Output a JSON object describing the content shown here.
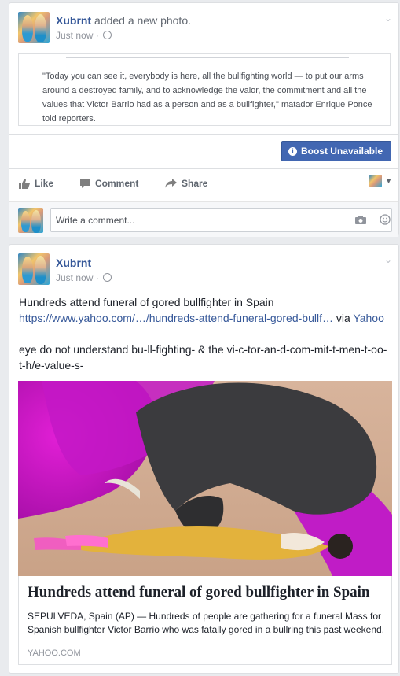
{
  "post1": {
    "author": "Xubrnt",
    "action": "added a new photo.",
    "timestamp": "Just now",
    "quote": "\"Today you can see it, everybody is here, all the bullfighting world — to put our arms around a destroyed family, and to acknowledge the valor, the commitment and all the values that Victor Barrio had as a person and as a bullfighter,\" matador Enrique Ponce told reporters.",
    "boost_label": "Boost Unavailable",
    "actions": {
      "like": "Like",
      "comment": "Comment",
      "share": "Share"
    },
    "comment_placeholder": "Write a comment..."
  },
  "post2": {
    "author": "Xubrnt",
    "timestamp": "Just now",
    "text_line1": "Hundreds attend funeral of gored bullfighter in Spain",
    "link_url": "https://www.yahoo.com/…/hundreds-attend-funeral-gored-bullf…",
    "via": "via",
    "via_source": "Yahoo",
    "comment_text": "eye do not understand bu-ll-fighting- & the vi-c-tor-an-d-com-mit-t-men-t-oo-t-h/e-value-s-",
    "link_preview": {
      "title": "Hundreds attend funeral of gored bullfighter in Spain",
      "description": "SEPULVEDA, Spain (AP) — Hundreds of people are gathering for a funeral Mass for Spanish bullfighter Victor Barrio who was fatally gored in a bullring this past weekend.",
      "domain": "YAHOO.COM"
    }
  },
  "colors": {
    "accent": "#4267b2",
    "link": "#365899",
    "muted": "#90949c",
    "page_bg": "#e9ebee"
  }
}
